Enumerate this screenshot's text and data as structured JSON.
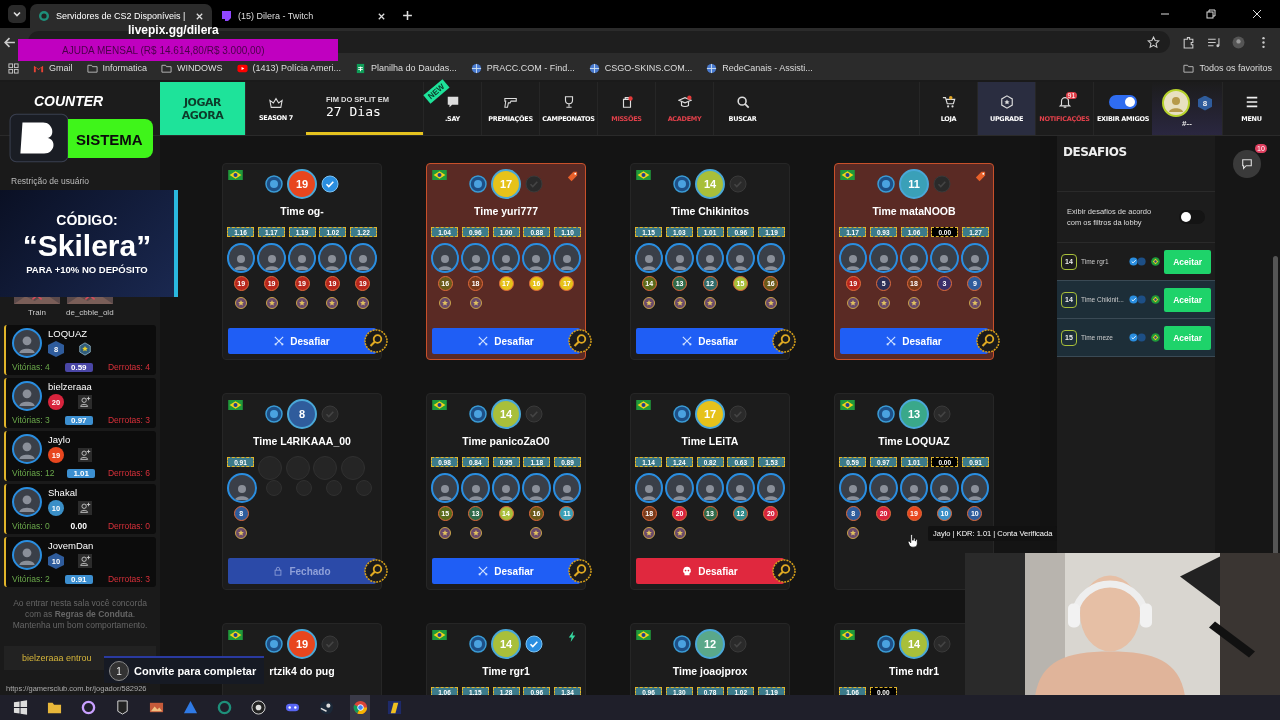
{
  "browser": {
    "tabs": [
      {
        "title": "Servidores de CS2 Disponíveis |",
        "selected": true
      },
      {
        "title": "(15) Dilera - Twitch",
        "selected": false
      }
    ],
    "bookmarks": [
      {
        "label": "Gmail",
        "kind": "mail"
      },
      {
        "label": "Informatica",
        "kind": "folder"
      },
      {
        "label": "WINDOWS",
        "kind": "folder"
      },
      {
        "label": "(1413) Polícia Ameri...",
        "kind": "video"
      },
      {
        "label": "Planilha do Daudas...",
        "kind": "sheet"
      },
      {
        "label": "PRACC.COM - Find...",
        "kind": "site"
      },
      {
        "label": "CSGO-SKINS.COM...",
        "kind": "site"
      },
      {
        "label": "RedeCanais - Assisti...",
        "kind": "site"
      }
    ],
    "all_bookmarks": "Todos os favoritos"
  },
  "stream_overlay": {
    "donation_link": "livepix.gg/dilera",
    "goal": "AJUDA MENSAL (R$ 14.614,80/R$ 3.000,00)",
    "brand": "SISTEMA",
    "promo": {
      "title": "CÓDIGO:",
      "code": "“Skilera”",
      "subtitle": "PARA +10% NO DEPÓSITO"
    },
    "invite": {
      "count": "1",
      "text": "Convite para completar"
    }
  },
  "site_nav": {
    "logo": "COUNTER",
    "play": "JOGAR AGORA",
    "season": "SEASON 7",
    "split_label": "FIM DO SPLIT EM",
    "split_value": "27 Dias",
    "items": [
      {
        "label": ".SAY",
        "alert": false,
        "badge": "NEW"
      },
      {
        "label": "PREMIAÇÕES",
        "alert": false
      },
      {
        "label": "CAMPEONATOS",
        "alert": false
      },
      {
        "label": "MISSÕES",
        "alert": true
      },
      {
        "label": "ACADEMY",
        "alert": true
      },
      {
        "label": "BUSCAR",
        "alert": false
      }
    ],
    "right_items": [
      {
        "label": "LOJA",
        "alert": false,
        "highlighted": false
      },
      {
        "label": "UPGRADE",
        "alert": false,
        "highlighted": true
      },
      {
        "label": "NOTIFICAÇÕES",
        "alert": true,
        "highlighted": false,
        "badge": "91"
      }
    ],
    "friends_toggle": {
      "label": "EXIBIR AMIGOS",
      "on": true
    },
    "profile": {
      "level": "8",
      "rank": "#--"
    },
    "menu": "MENU"
  },
  "sidebar": {
    "restriction": "Restrição de usuário",
    "maps": [
      "Train",
      "de_cbble_old"
    ],
    "players": [
      {
        "name": "LOQUAZ",
        "level_badge": {
          "text": "8",
          "kind": "hex",
          "color": "#2f5c9c"
        },
        "wins": "Vitórias: 4",
        "kdr_badge": {
          "text": "0.59",
          "color": "#4a46a6"
        },
        "losses": "Derrotas: 4",
        "friend_button": false
      },
      {
        "name": "bielzeraaa",
        "level_badge": {
          "text": "20",
          "kind": "circle",
          "color": "#d8243d"
        },
        "wins": "Vitórias: 3",
        "kdr_badge": {
          "text": "0.97",
          "color": "#3c8fd0"
        },
        "losses": "Derrotas: 3",
        "friend_button": true
      },
      {
        "name": "Jaylo",
        "level_badge": {
          "text": "19",
          "kind": "circle",
          "color": "#e8461e"
        },
        "wins": "Vitórias: 12",
        "kdr_badge": {
          "text": "1.01",
          "color": "#3c8fd0"
        },
        "losses": "Derrotas: 6",
        "friend_button": true
      },
      {
        "name": "Shakal",
        "level_badge": {
          "text": "10",
          "kind": "circle",
          "color": "#3a8fc7"
        },
        "wins": "Vitórias: 0",
        "kdr_badge": {
          "text": "0.00"
        },
        "losses": "Derrotas: 0",
        "friend_button": true
      },
      {
        "name": "JovemDan",
        "level_badge": {
          "text": "10",
          "kind": "hex",
          "color": "#2f5c9c"
        },
        "wins": "Vitórias: 2",
        "kdr_badge": {
          "text": "0.91",
          "color": "#3c8fd0"
        },
        "losses": "Derrotas: 3",
        "friend_button": true
      }
    ],
    "rules": "Ao entrar nesta sala você concorda com as **Regras de Conduta**. Mantenha um bom comportamento.",
    "event": "bielzeraaa entrou"
  },
  "teams": [
    {
      "name": "Time og-",
      "level": "19",
      "color": "#e8461e",
      "verified": true,
      "highlighted": false,
      "kdrs": [
        "1.16",
        "1.17",
        "1.19",
        "1.02",
        "1.22"
      ],
      "players": [
        {
          "level": "19",
          "color": "#b8261c",
          "medal": true
        },
        {
          "level": "19",
          "color": "#b8261c",
          "medal": true
        },
        {
          "level": "19",
          "color": "#b8261c",
          "medal": true
        },
        {
          "level": "19",
          "color": "#b8261c",
          "medal": true
        },
        {
          "level": "19",
          "color": "#b8261c",
          "medal": true
        }
      ],
      "button": {
        "kind": "challenge",
        "label": "Desafiar"
      }
    },
    {
      "name": "Time yuri777",
      "level": "17",
      "color": "#e6c21a",
      "verified": false,
      "highlighted": true,
      "corner": {
        "kind": "tag"
      },
      "kdrs": [
        "1.04",
        "0.96",
        "1.00",
        "0.88",
        "1.10"
      ],
      "players": [
        {
          "level": "16",
          "color": "#6b5a1a",
          "medal": true
        },
        {
          "level": "18",
          "color": "#7a3a1a",
          "medal": true
        },
        {
          "level": "17",
          "color": "#e6c21a",
          "medal": false
        },
        {
          "level": "16",
          "color": "#e6c21a",
          "medal": false
        },
        {
          "level": "17",
          "color": "#e6c21a",
          "medal": false
        }
      ],
      "button": {
        "kind": "challenge",
        "label": "Desafiar"
      }
    },
    {
      "name": "Time Chikinitos",
      "level": "14",
      "color": "#a8bf3a",
      "verified": false,
      "highlighted": false,
      "kdrs": [
        "1.15",
        "1.03",
        "1.01",
        "0.96",
        "1.19"
      ],
      "players": [
        {
          "level": "14",
          "color": "#5a6a1a",
          "medal": true
        },
        {
          "level": "13",
          "color": "#2f6a4a",
          "medal": true
        },
        {
          "level": "12",
          "color": "#2f6a6a",
          "medal": true
        },
        {
          "level": "15",
          "color": "#a8bf3a",
          "medal": false
        },
        {
          "level": "16",
          "color": "#6b5a1a",
          "medal": true
        }
      ],
      "button": {
        "kind": "challenge",
        "label": "Desafiar"
      }
    },
    {
      "name": "Time mataNOOB",
      "level": "11",
      "color": "#3aa0b8",
      "verified": false,
      "highlighted": true,
      "corner": {
        "kind": "tag"
      },
      "kdrs": [
        "1.17",
        "0.93",
        "1.06",
        "0.00",
        "1.27"
      ],
      "players": [
        {
          "level": "19",
          "color": "#b8261c",
          "medal": true
        },
        {
          "level": "5",
          "color": "#2b2f55",
          "medal": true
        },
        {
          "level": "18",
          "color": "#7a3a1a",
          "medal": true
        },
        {
          "level": "3",
          "color": "#3b2f6a",
          "medal": false
        },
        {
          "level": "9",
          "color": "#2f5c9c",
          "medal": true
        }
      ],
      "button": {
        "kind": "challenge",
        "label": "Desafiar"
      }
    },
    {
      "name": "Time L4RIKAAA_00",
      "level": "8",
      "color": "#2f5c9c",
      "verified": false,
      "highlighted": false,
      "kdrs": [
        "0.91"
      ],
      "players": [
        {
          "level": "8",
          "color": "#2f5c9c",
          "medal": true
        }
      ],
      "button": {
        "kind": "closed",
        "label": "Fechado"
      }
    },
    {
      "name": "Time panicoZaO0",
      "level": "14",
      "color": "#a8bf3a",
      "verified": false,
      "highlighted": false,
      "kdrs": [
        "0.98",
        "0.84",
        "0.95",
        "1.18",
        "0.89"
      ],
      "players": [
        {
          "level": "15",
          "color": "#5a6a1a",
          "medal": true
        },
        {
          "level": "13",
          "color": "#2f6a4a",
          "medal": true
        },
        {
          "level": "14",
          "color": "#a8bf3a",
          "medal": false
        },
        {
          "level": "16",
          "color": "#6b5a1a",
          "medal": true
        },
        {
          "level": "11",
          "color": "#3aa0b8",
          "medal": false
        }
      ],
      "button": {
        "kind": "challenge",
        "label": "Desafiar"
      }
    },
    {
      "name": "Time LEiTA",
      "level": "17",
      "color": "#e6c21a",
      "verified": false,
      "highlighted": false,
      "kdrs": [
        "1.14",
        "1.24",
        "0.82",
        "0.63",
        "1.53"
      ],
      "players": [
        {
          "level": "18",
          "color": "#7a3a1a",
          "medal": true
        },
        {
          "level": "20",
          "color": "#d8243d",
          "medal": true
        },
        {
          "level": "13",
          "color": "#2f6a4a",
          "medal": false
        },
        {
          "level": "12",
          "color": "#2f8a8a",
          "medal": false
        },
        {
          "level": "20",
          "color": "#d8243d",
          "medal": false
        }
      ],
      "button": {
        "kind": "danger",
        "label": "Desafiar"
      }
    },
    {
      "name": "Time LOQUAZ",
      "level": "13",
      "color": "#3aa88a",
      "verified": false,
      "highlighted": false,
      "kdrs": [
        "0.59",
        "0.97",
        "1.01",
        "0.00",
        "0.91"
      ],
      "players": [
        {
          "level": "8",
          "color": "#2f5c9c",
          "medal": true
        },
        {
          "level": "20",
          "color": "#d8243d",
          "medal": false
        },
        {
          "level": "19",
          "color": "#e8461e",
          "medal": false
        },
        {
          "level": "10",
          "color": "#3a8fc7"
        },
        {
          "level": "10",
          "color": "#2f5c9c"
        }
      ]
    },
    {
      "name": "rtzik4 do pug",
      "level": "19",
      "color": "#e8461e",
      "verified": false,
      "highlighted": false
    },
    {
      "name": "Time rgr1",
      "level": "14",
      "color": "#a8bf3a",
      "verified": true,
      "highlighted": false,
      "corner": {
        "kind": "bolt"
      },
      "kdrs": [
        "1.06",
        "1.15",
        "1.28",
        "0.96",
        "1.34"
      ]
    },
    {
      "name": "Time joaojprox",
      "level": "12",
      "color": "#5aa88a",
      "verified": false,
      "highlighted": false,
      "kdrs": [
        "0.96",
        "1.30",
        "0.78",
        "1.02",
        "1.19"
      ]
    },
    {
      "name": "Time ndr1",
      "level": "14",
      "color": "#a8bf3a",
      "verified": false,
      "highlighted": false,
      "kdrs": [
        "1.06",
        "0.00"
      ]
    }
  ],
  "tooltip": "Jaylo | KDR: 1.01 | Conta Verificada",
  "challenges": {
    "title": "DESAFIOS",
    "filter": {
      "label": "Exibir desafios de acordo com os filtros da lobby",
      "on": false
    },
    "items": [
      {
        "level": "14",
        "name": "Time rgr1",
        "action": "Aceitar",
        "highlighted": false
      },
      {
        "level": "14",
        "name": "Time Chikinit...",
        "action": "Aceitar",
        "highlighted": true
      },
      {
        "level": "15",
        "name": "Time meze",
        "action": "Aceitar",
        "highlighted": true
      }
    ]
  },
  "chat": {
    "badge": "10"
  },
  "status_url": "https://gamersclub.com.br/jogador/582926"
}
